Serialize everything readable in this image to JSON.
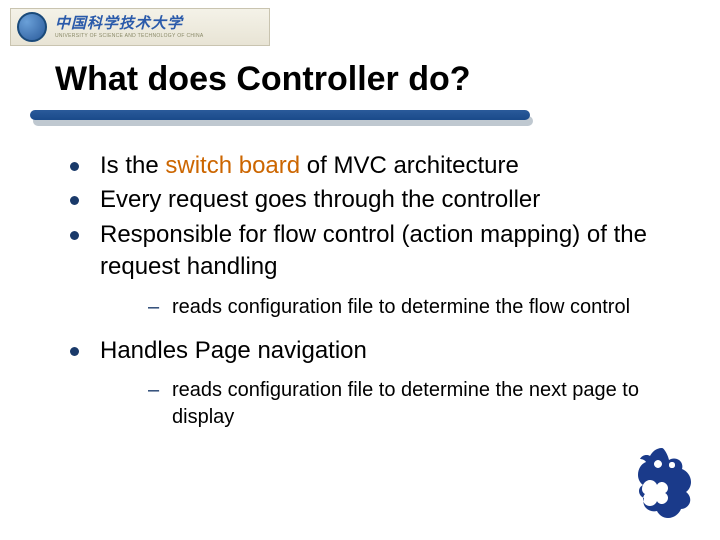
{
  "logo": {
    "cn": "中国科学技术大学",
    "en": "UNIVERSITY OF SCIENCE AND TECHNOLOGY OF CHINA"
  },
  "title": "What does Controller do?",
  "bullets": [
    {
      "pre": "Is the ",
      "highlight": "switch board",
      "post": " of MVC architecture"
    },
    {
      "text": "Every request goes through the controller"
    },
    {
      "text": "Responsible for flow control (action mapping) of the request handling",
      "sub": [
        "reads configuration file to determine the flow control"
      ]
    },
    {
      "text": "Handles Page navigation",
      "sub": [
        "reads configuration file to determine the next page to display"
      ]
    }
  ]
}
